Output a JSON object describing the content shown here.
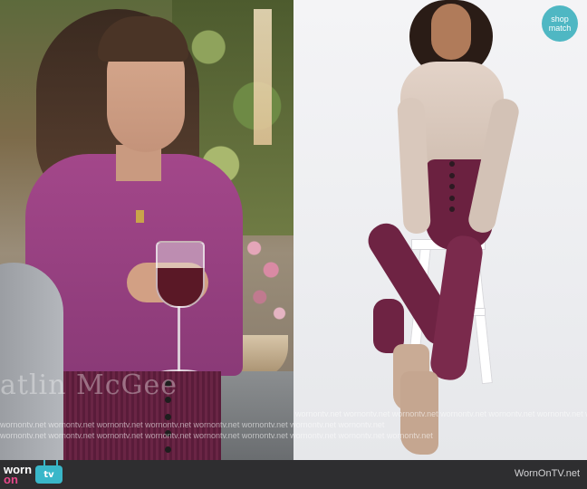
{
  "overlay": {
    "caption_ghost": "atlin McGee",
    "match_badge": {
      "line1": "shop",
      "line2": "match"
    },
    "watermark_row1": "wornontv.net  wornontv.net  wornontv.net  wornontv.net  wornontv.net  wornontv.net  wornontv.net",
    "watermark_row2": "wornontv.net  wornontv.net  wornontv.net  wornontv.net  wornontv.net  wornontv.net  wornontv.net  wornontv.net",
    "watermark_row3": "wornontv.net  wornontv.net  wornontv.net  wornontv.net  wornontv.net  wornontv.net  wornontv.net  wornontv.net  wornontv.net"
  },
  "footer": {
    "logo_line1": "worn",
    "logo_line2": "on",
    "logo_tv": "tv",
    "site_url": "WornOnTV.net"
  },
  "colors": {
    "badge": "#4fb7c3",
    "footer_bg": "#2e2e30",
    "logo_accent": "#e8488a",
    "logo_tv_bg": "#39b7c9"
  }
}
